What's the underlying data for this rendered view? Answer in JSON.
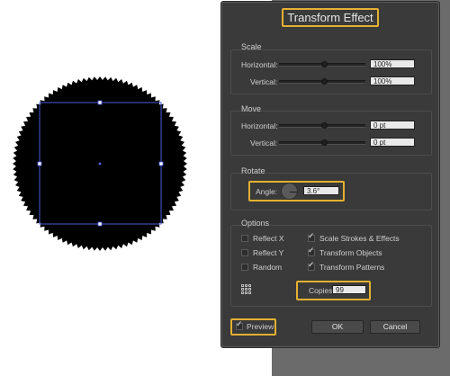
{
  "dialog": {
    "title": "Transform Effect",
    "scale": {
      "label": "Scale",
      "horizontal": {
        "label": "Horizontal:",
        "value": "100%"
      },
      "vertical": {
        "label": "Vertical:",
        "value": "100%"
      }
    },
    "move": {
      "label": "Move",
      "horizontal": {
        "label": "Horizontal:",
        "value": "0 pt"
      },
      "vertical": {
        "label": "Vertical:",
        "value": "0 pt"
      }
    },
    "rotate": {
      "label": "Rotate",
      "angle_label": "Angle:",
      "angle_value": "3.6°"
    },
    "options": {
      "label": "Options",
      "reflect_x": {
        "label": "Reflect X",
        "checked": false
      },
      "reflect_y": {
        "label": "Reflect Y",
        "checked": false
      },
      "random": {
        "label": "Random",
        "checked": false
      },
      "scale_strokes": {
        "label": "Scale Strokes & Effects",
        "checked": true
      },
      "transform_objects": {
        "label": "Transform Objects",
        "checked": true
      },
      "transform_patterns": {
        "label": "Transform Patterns",
        "checked": true
      },
      "copies_label": "Copies",
      "copies_value": "99"
    },
    "preview": {
      "label": "Preview",
      "checked": true
    },
    "ok_label": "OK",
    "cancel_label": "Cancel"
  },
  "colors": {
    "highlight": "#e4b132",
    "dialog_bg": "#3a3a3a",
    "selection": "#4b5bd6",
    "artwork": "#000000"
  },
  "icons": [
    "reference-point-icon",
    "rotate-dial-icon",
    "checkmark-icon"
  ]
}
